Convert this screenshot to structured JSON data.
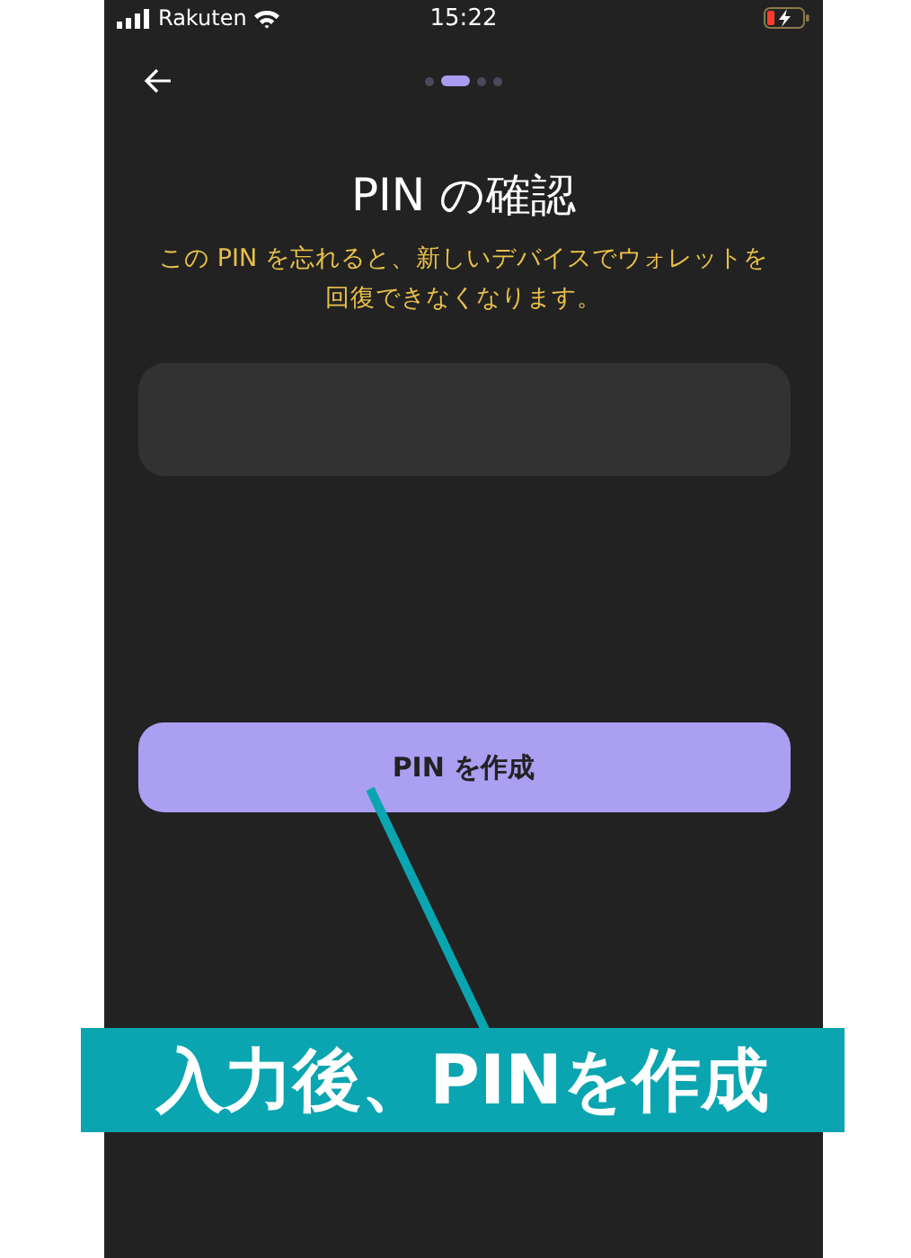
{
  "status_bar": {
    "carrier": "Rakuten",
    "time": "15:22"
  },
  "steps": [
    {
      "selected": false
    },
    {
      "selected": true
    },
    {
      "selected": false
    },
    {
      "selected": false
    }
  ],
  "title": "PIN の確認",
  "warning": "この PIN を忘れると、新しいデバイスでウォレットを回復できなくなります。",
  "button": "PIN を作成",
  "annotation": {
    "caption": "入力後、PINを作成"
  }
}
